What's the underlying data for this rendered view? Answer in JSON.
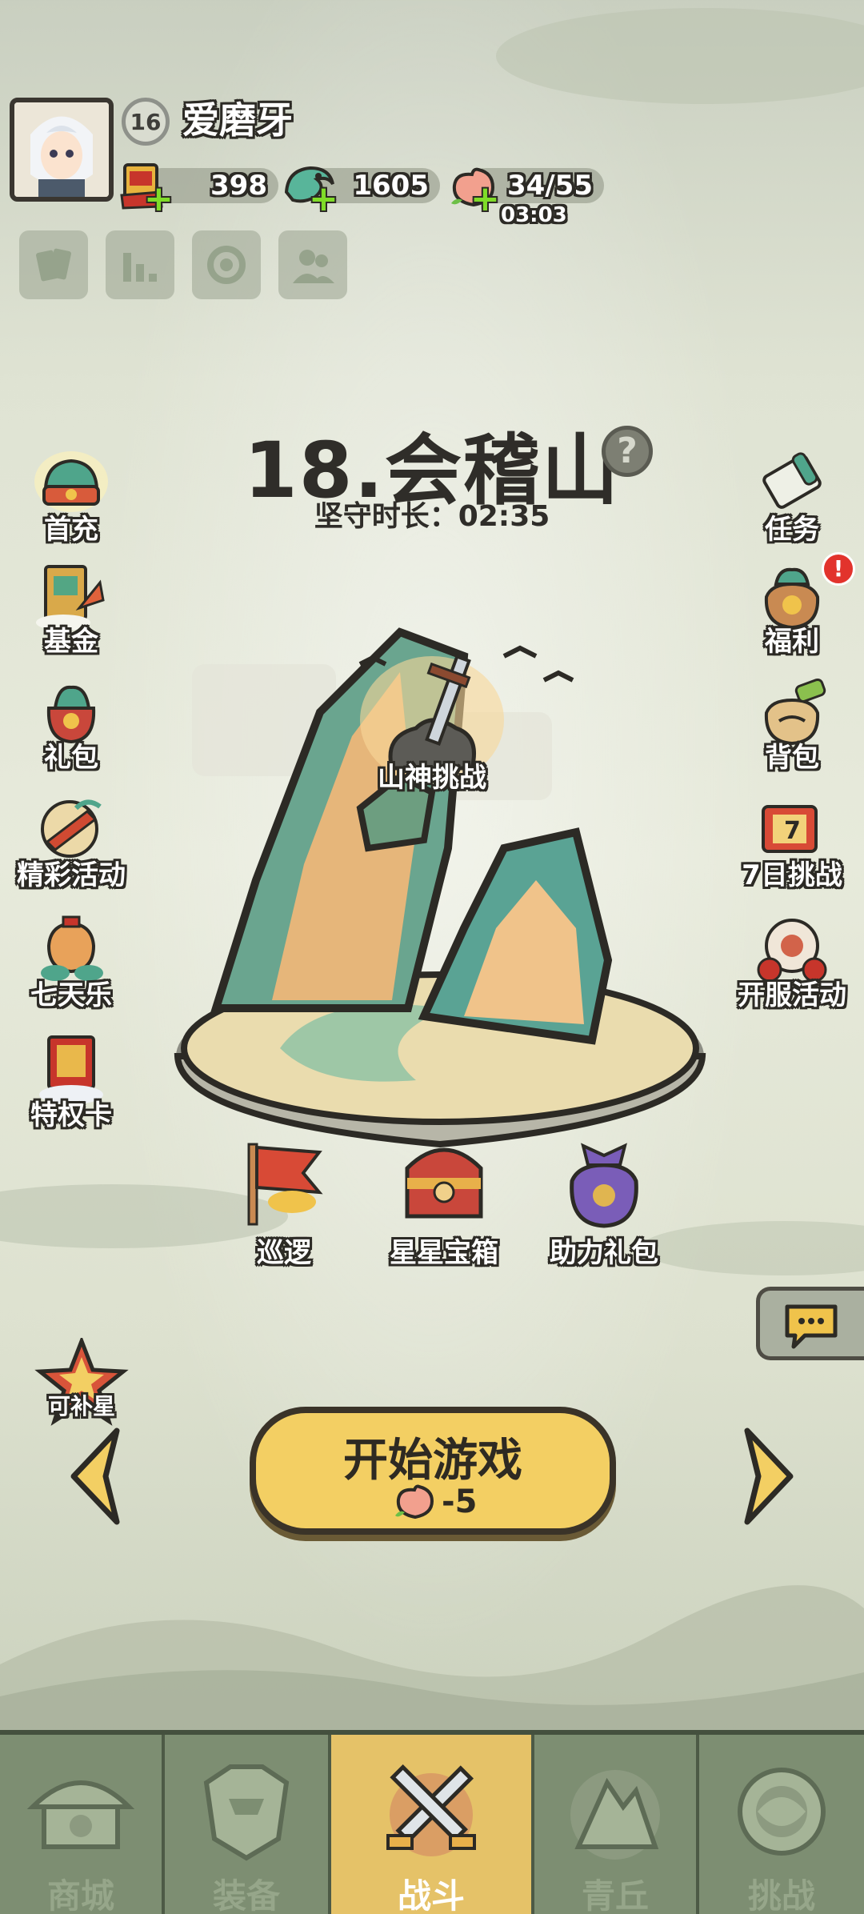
{
  "player": {
    "name": "爱磨牙",
    "level": "16"
  },
  "resources": {
    "tickets": "398",
    "jade": "1605",
    "stamina": "34/55",
    "stamina_timer": "03:03"
  },
  "stage": {
    "title": "18.会稽山",
    "guard_time": "坚守时长：02:35",
    "boss_label": "山神挑战"
  },
  "left_menu": [
    {
      "label": "首充",
      "icon": "first-recharge-icon"
    },
    {
      "label": "基金",
      "icon": "fund-icon"
    },
    {
      "label": "礼包",
      "icon": "gift-pack-icon"
    },
    {
      "label": "精彩活动",
      "icon": "events-icon"
    },
    {
      "label": "七天乐",
      "icon": "seven-day-icon"
    },
    {
      "label": "特权卡",
      "icon": "privilege-card-icon"
    }
  ],
  "right_menu": [
    {
      "label": "任务",
      "icon": "task-scroll-icon"
    },
    {
      "label": "福利",
      "icon": "welfare-bag-icon",
      "badge": "!"
    },
    {
      "label": "背包",
      "icon": "backpack-icon"
    },
    {
      "label": "7日挑战",
      "icon": "seven-day-challenge-icon"
    },
    {
      "label": "开服活动",
      "icon": "server-event-icon"
    }
  ],
  "island_items": [
    {
      "label": "巡逻",
      "icon": "patrol-flag-icon"
    },
    {
      "label": "星星宝箱",
      "icon": "star-chest-icon"
    },
    {
      "label": "助力礼包",
      "icon": "assist-gift-bag-icon"
    }
  ],
  "star_badge": "可补星",
  "start": {
    "label": "开始游戏",
    "cost": "-5"
  },
  "nav": [
    {
      "label": "商城",
      "icon": "shop-icon"
    },
    {
      "label": "装备",
      "icon": "equipment-icon"
    },
    {
      "label": "战斗",
      "icon": "battle-icon"
    },
    {
      "label": "青丘",
      "icon": "qingqiu-icon"
    },
    {
      "label": "挑战",
      "icon": "challenge-icon"
    }
  ],
  "active_tab": "战斗",
  "colors": {
    "accent_yellow": "#f3cf63",
    "nav_bg": "#7d8e72",
    "alert_red": "#e2332c"
  }
}
